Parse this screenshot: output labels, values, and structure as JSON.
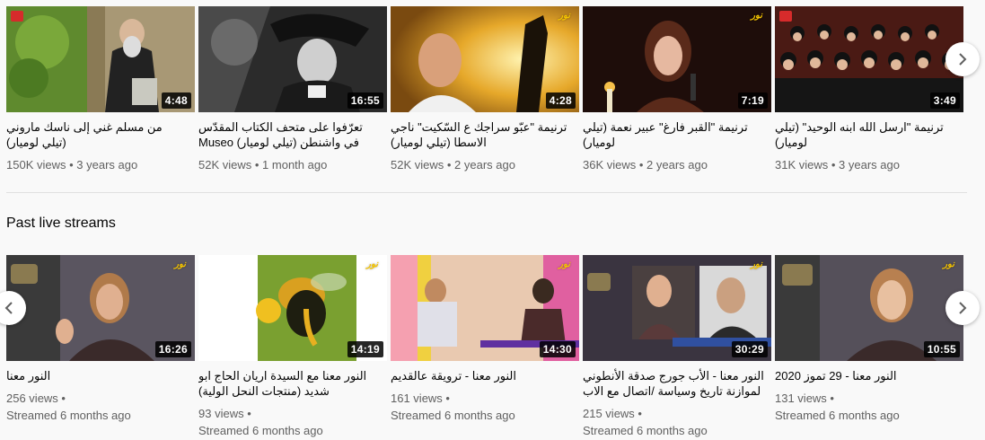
{
  "shelf1": {
    "videos": [
      {
        "title": "من مسلم غني إلى ناسك ماروني (تيلي لوميار)",
        "duration": "4:48",
        "views": "150K views",
        "age": "3 years ago"
      },
      {
        "title": "تعرّفوا على متحف الكتاب المقدّس في واشنطن (تيلي لوميار) Museo dell...",
        "duration": "16:55",
        "views": "52K views",
        "age": "1 month ago"
      },
      {
        "title": "ترنيمة \"عبّو سراجك ع السّكيت\" ناجي الاسطا (تيلي لوميار)",
        "duration": "4:28",
        "views": "52K views",
        "age": "2 years ago"
      },
      {
        "title": "ترنيمة \"القبر فارغ\" عبير نعمة (تيلي لوميار)",
        "duration": "7:19",
        "views": "36K views",
        "age": "2 years ago"
      },
      {
        "title": "ترنيمة \"ارسل الله ابنه الوحيد\" (تيلي لوميار)",
        "duration": "3:49",
        "views": "31K views",
        "age": "3 years ago"
      }
    ]
  },
  "shelf2": {
    "title": "Past live streams",
    "videos": [
      {
        "title": "النور معنا",
        "duration": "16:26",
        "views": "256 views •",
        "age": "Streamed 6 months ago"
      },
      {
        "title": "النور معنا مع السيدة اريان الحاج ابو شديد (منتجات النحل الولية)",
        "duration": "14:19",
        "views": "93 views •",
        "age": "Streamed 6 months ago"
      },
      {
        "title": "النور معنا - ترويقة عالقديم",
        "duration": "14:30",
        "views": "161 views •",
        "age": "Streamed 6 months ago"
      },
      {
        "title": "النور معنا - الأب جورج صدقة الأنطوني لموازنة تاريخ وسياسة /اتصال مع الاب",
        "duration": "30:29",
        "views": "215 views •",
        "age": "Streamed 6 months ago"
      },
      {
        "title": "النور معنا - 29 تموز 2020",
        "duration": "10:55",
        "views": "131 views •",
        "age": "Streamed 6 months ago"
      }
    ]
  },
  "icons": {
    "next": "chevron-right-icon",
    "prev": "chevron-left-icon"
  }
}
